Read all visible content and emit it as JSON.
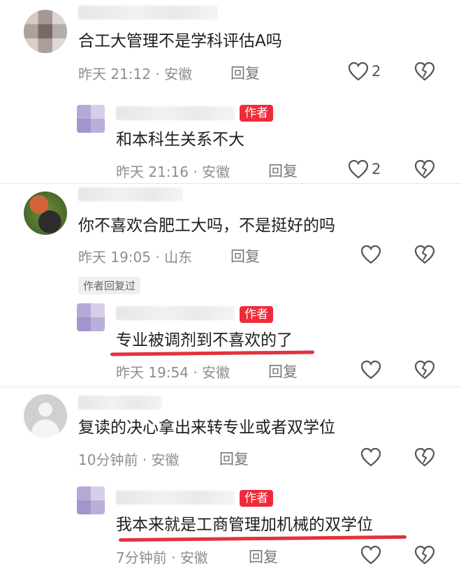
{
  "badge_label": "作者",
  "author_replied_label": "作者回复过",
  "reply_label": "回复",
  "colors": {
    "badge": "#ee2b3a",
    "underline": "#e2323c",
    "meta": "#8e8e8e"
  },
  "comments": [
    {
      "text": "合工大管理不是学科评估A吗",
      "time": "昨天 21:12",
      "location": "安徽",
      "likes": "2"
    },
    {
      "text": "和本科生关系不大",
      "time": "昨天 21:16",
      "location": "安徽",
      "likes": "2"
    },
    {
      "text": "你不喜欢合肥工大吗，不是挺好的吗",
      "time": "昨天 19:05",
      "location": "山东",
      "likes": ""
    },
    {
      "text": "专业被调剂到不喜欢的了",
      "time": "昨天 19:54",
      "location": "安徽",
      "likes": ""
    },
    {
      "text": "复读的决心拿出来转专业或者双学位",
      "time": "10分钟前",
      "location": "安徽",
      "likes": ""
    },
    {
      "text": "我本来就是工商管理加机械的双学位",
      "time": "7分钟前",
      "location": "安徽",
      "likes": ""
    }
  ]
}
